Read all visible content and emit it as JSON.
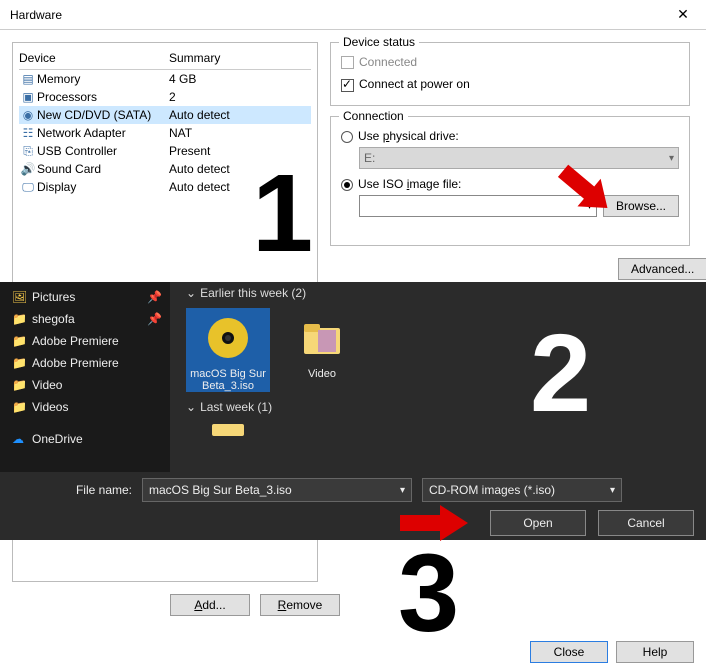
{
  "window": {
    "title": "Hardware"
  },
  "devices": {
    "head_device": "Device",
    "head_summary": "Summary",
    "rows": [
      {
        "icon": "memory-icon",
        "name": "Memory",
        "summary": "4 GB"
      },
      {
        "icon": "cpu-icon",
        "name": "Processors",
        "summary": "2"
      },
      {
        "icon": "cd-icon",
        "name": "New CD/DVD (SATA)",
        "summary": "Auto detect",
        "selected": true
      },
      {
        "icon": "net-icon",
        "name": "Network Adapter",
        "summary": "NAT"
      },
      {
        "icon": "usb-icon",
        "name": "USB Controller",
        "summary": "Present"
      },
      {
        "icon": "sound-icon",
        "name": "Sound Card",
        "summary": "Auto detect"
      },
      {
        "icon": "display-icon",
        "name": "Display",
        "summary": "Auto detect"
      }
    ]
  },
  "status": {
    "legend": "Device status",
    "connected": "Connected",
    "connect_poweron": "Connect at power on"
  },
  "connection": {
    "legend": "Connection",
    "use_physical_pre": "Use ",
    "use_physical_ul": "p",
    "use_physical_post": "hysical drive:",
    "drive_value": "E:",
    "use_iso_label": "Use ISO image file:",
    "use_iso_ul": "i",
    "iso_value": "",
    "browse_label": "Browse...",
    "advanced_label": "Advanced..."
  },
  "mid_buttons": {
    "add": "Add...",
    "remove": "Remove"
  },
  "picker": {
    "sidebar": [
      {
        "icon": "folder",
        "label": "Pictures",
        "pinned": true
      },
      {
        "icon": "folder",
        "label": "shegofa",
        "pinned": true
      },
      {
        "icon": "folder",
        "label": "Adobe Premiere"
      },
      {
        "icon": "folder",
        "label": "Adobe Premiere"
      },
      {
        "icon": "folder",
        "label": "Video"
      },
      {
        "icon": "folder",
        "label": "Videos"
      },
      {
        "icon": "cloud",
        "label": "OneDrive"
      }
    ],
    "group1": "Earlier this week (2)",
    "file1": "macOS Big Sur Beta_3.iso",
    "file2": "Video",
    "group2": "Last week (1)",
    "filename_label": "File name:",
    "filename_value": "macOS Big Sur Beta_3.iso",
    "filter_value": "CD-ROM images (*.iso)",
    "open": "Open",
    "cancel": "Cancel"
  },
  "bottom": {
    "close": "Close",
    "help": "Help"
  },
  "nums": {
    "one": "1",
    "two": "2",
    "three": "3"
  }
}
